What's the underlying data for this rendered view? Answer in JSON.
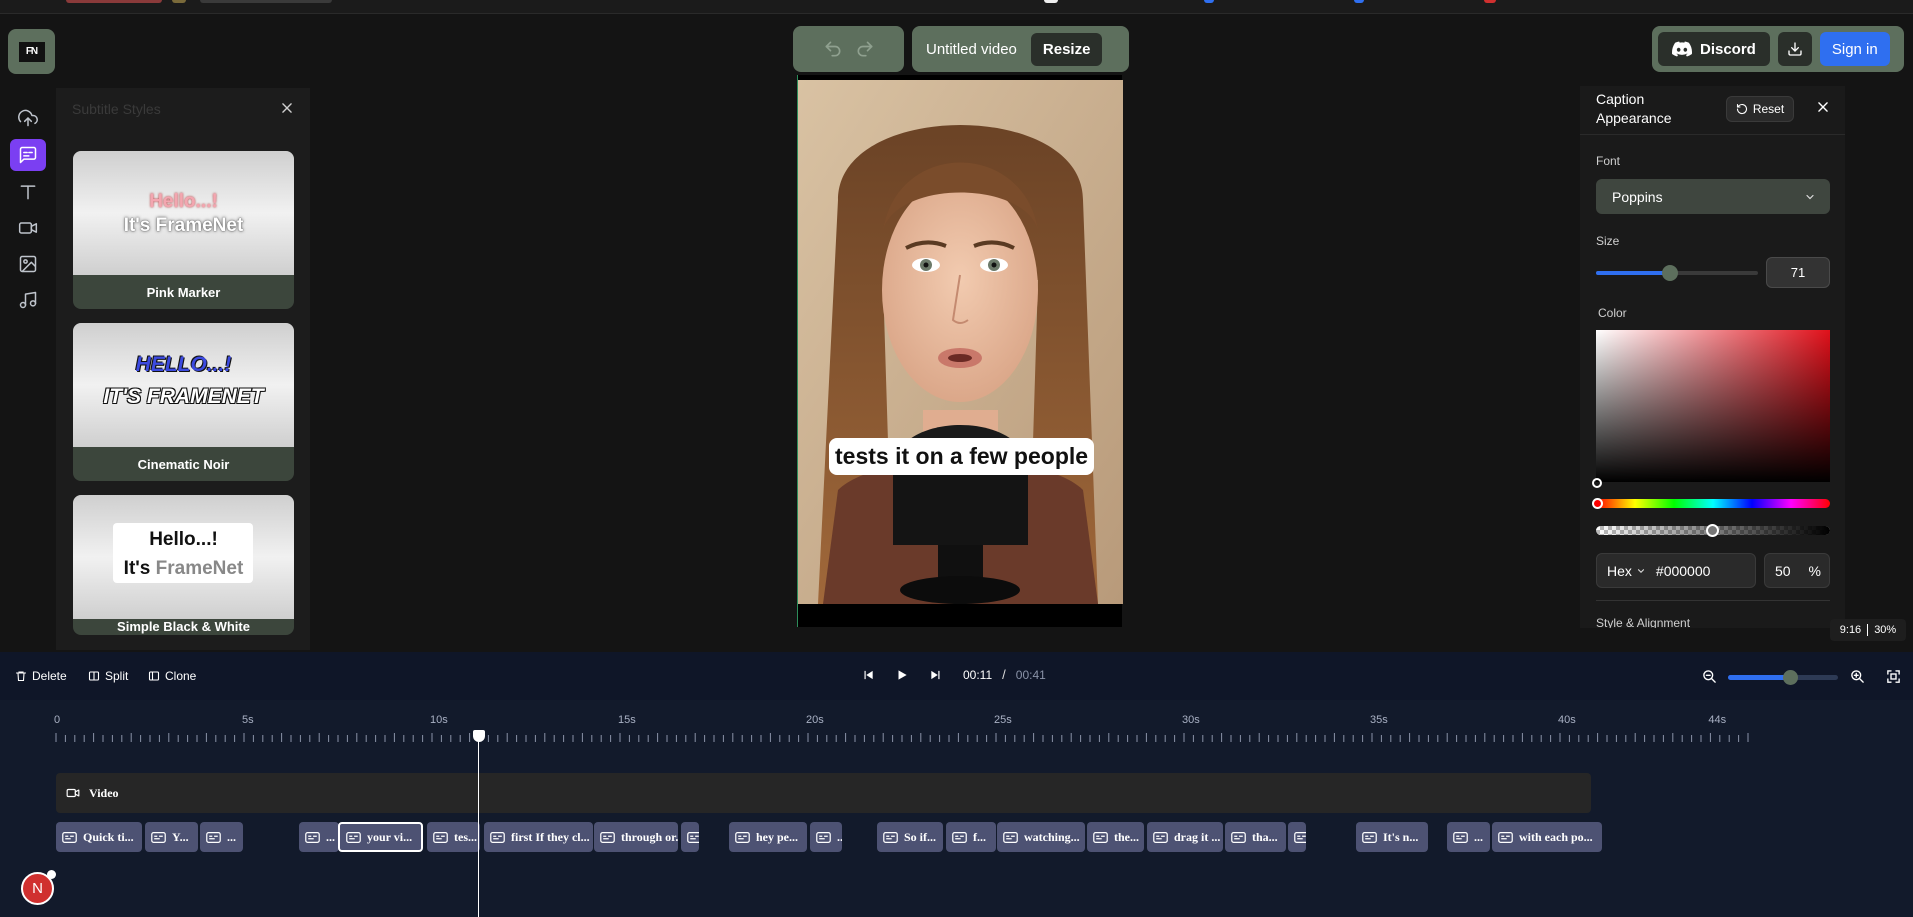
{
  "app": {
    "logo_text": "FN",
    "video_title": "Untitled video",
    "resize_label": "Resize",
    "discord_label": "Discord",
    "signin_label": "Sign in"
  },
  "styles_panel": {
    "title": "Subtitle Styles",
    "cards": [
      {
        "name": "Pink Marker",
        "line1": "Hello...!",
        "line2": "It's FrameNet"
      },
      {
        "name": "Cinematic Noir",
        "line1": "HELLO...!",
        "line2": "IT'S FRAMENET"
      },
      {
        "name": "Simple Black & White",
        "line1": "Hello...!",
        "line2_a": "It's ",
        "line2_b": "FrameNet"
      }
    ]
  },
  "canvas": {
    "caption": "tests it on a few people"
  },
  "caption_panel": {
    "title": "Caption Appearance",
    "reset_label": "Reset",
    "font_label": "Font",
    "font_value": "Poppins",
    "size_label": "Size",
    "size_value": "71",
    "color_label": "Color",
    "color_mode": "Hex",
    "hex_value": "#000000",
    "opacity_value": "50",
    "opacity_unit": "%",
    "next_section": "Style & Alignment",
    "size_fraction": 0.45,
    "colors": {
      "hue": "#e0101a",
      "accent": "#2f6ff0"
    }
  },
  "status": {
    "ratio": "9:16",
    "zoom": "30%"
  },
  "timeline": {
    "delete_label": "Delete",
    "split_label": "Split",
    "clone_label": "Clone",
    "current_time": "00:11",
    "separator": "/",
    "total_time": "00:41",
    "ruler_labels": [
      "0",
      "5s",
      "10s",
      "15s",
      "20s",
      "25s",
      "30s",
      "35s",
      "40s",
      "44s"
    ],
    "video_track_label": "Video",
    "clips": [
      "Quick ti...",
      "Y...",
      "...",
      "...",
      "your vi...",
      "tes...",
      "first If they cl...",
      "through or...",
      "",
      "hey pe...",
      "...",
      "So if...",
      "f...",
      "watching...",
      "the...",
      "drag it ...",
      "tha...",
      "",
      "It's n...",
      "...",
      "with each po..."
    ],
    "avatar_initial": "N"
  }
}
